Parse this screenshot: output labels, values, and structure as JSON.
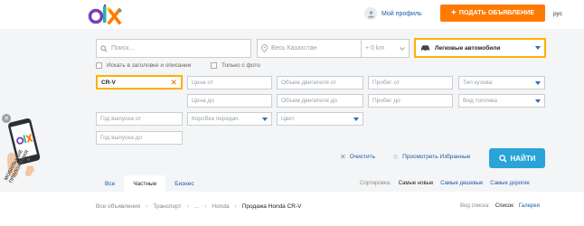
{
  "header": {
    "profile_label": "Мой профиль",
    "post_button": "ПОДАТЬ ОБЪЯВЛЕНИЕ",
    "lang": "рус",
    "logo_text": "OLX"
  },
  "search": {
    "query_placeholder": "Поиск...",
    "location": "Весь Казахстан",
    "radius": "+ 0 km",
    "category": "Легковые автомобили",
    "opt_title_desc": "Искать в заголовке и описании",
    "opt_photo_only": "Только с фото"
  },
  "filters": {
    "model": "CR-V",
    "price_from": "Цена от",
    "price_to": "Цена до",
    "engine_from": "Объем двигателя от",
    "engine_to": "Объем двигателя до",
    "mileage_from": "Пробег от",
    "mileage_to": "Пробег до",
    "body_type": "Тип кузова",
    "fuel_type": "Вид топлива",
    "year_from": "Год выпуска от",
    "year_to": "Год выпуска до",
    "gearbox": "Коробка передач",
    "color": "Цвет"
  },
  "actions": {
    "clear": "Очистить",
    "favorites": "Просмотреть Избранные",
    "find": "НАЙТИ"
  },
  "promo": {
    "caption_line1": "МОБИЛЬНЫЕ",
    "caption_line2": "ПРИЛОЖЕНИЯ"
  },
  "tabs": [
    "Все",
    "Частные",
    "Бизнес"
  ],
  "sort": {
    "label": "Сортировка:",
    "newest": "Самые новые",
    "cheapest": "Самые дешевые",
    "expensive": "Самые дорогие"
  },
  "breadcrumb": [
    "Все объявления",
    "Транспорт",
    "...",
    "Honda",
    "Продажа Honda CR-V"
  ],
  "view": {
    "label": "Вид списка:",
    "list": "Список",
    "gallery": "Галерея"
  },
  "colors": {
    "accent_orange": "#ff7a00",
    "highlight_border": "#ffb000",
    "button_blue": "#29a3d8",
    "link_blue": "#1a5aa8"
  }
}
